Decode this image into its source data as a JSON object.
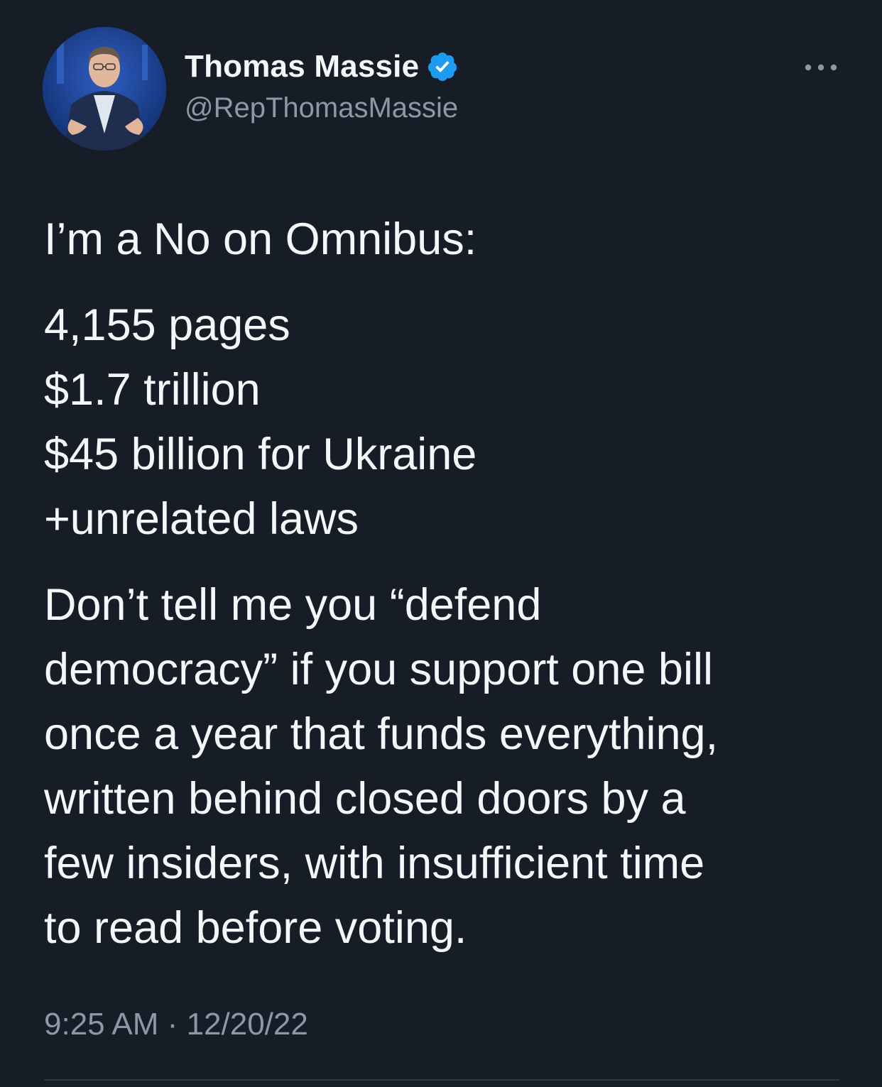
{
  "author": {
    "display_name": "Thomas Massie",
    "handle": "@RepThomasMassie",
    "verified": true,
    "verified_color": "#1d9bf0"
  },
  "tweet": {
    "paragraphs": [
      {
        "lines": [
          "I’m a No on Omnibus:"
        ]
      },
      {
        "lines": [
          "4,155 pages",
          "$1.7 trillion",
          "$45 billion for Ukraine",
          "+unrelated laws"
        ]
      },
      {
        "lines": [
          "Don’t tell me you “defend",
          "democracy” if you support one bill",
          "once a year that funds everything,",
          "written behind closed doors by a",
          "few insiders, with insufficient time",
          "to read before voting."
        ]
      }
    ],
    "time": "9:25 AM",
    "separator": "·",
    "date": "12/20/22"
  },
  "icons": {
    "verified": "verified-badge-icon",
    "more": "more-options-icon"
  },
  "colors": {
    "background": "#161d27",
    "text": "#f4f6f8",
    "secondary_text": "#8b98a5"
  }
}
